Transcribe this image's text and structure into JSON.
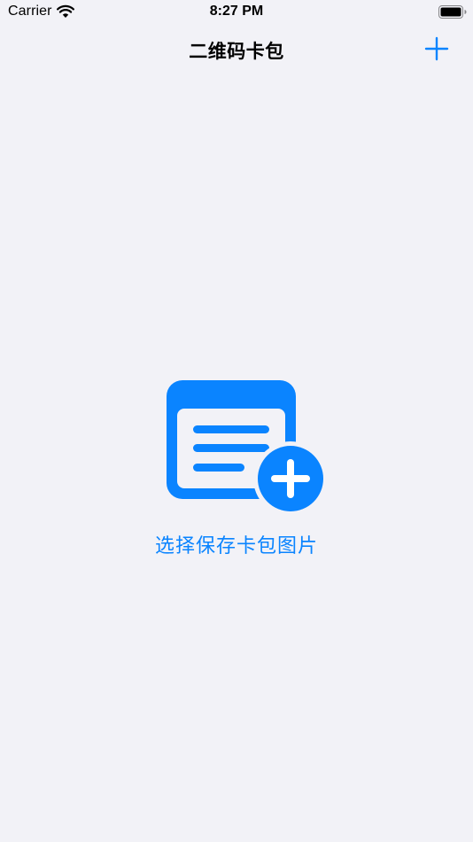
{
  "status_bar": {
    "carrier": "Carrier",
    "time": "8:27 PM"
  },
  "nav": {
    "title": "二维码卡包",
    "add_icon": "plus-icon"
  },
  "empty_state": {
    "label": "选择保存卡包图片",
    "icon": "card-add-icon"
  },
  "colors": {
    "accent": "#0a84ff",
    "background": "#f2f2f7"
  }
}
